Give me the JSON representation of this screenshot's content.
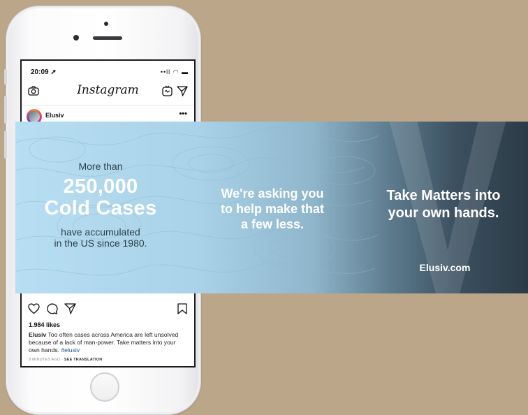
{
  "status_bar": {
    "time": "20:09 ➚",
    "icons": "••ll ◠ ▬"
  },
  "app": {
    "name": "Instagram"
  },
  "post": {
    "username": "Elusiv",
    "more": "•••",
    "likes": "1.984 likes",
    "caption_user": "Elusiv",
    "caption_text": " Too often cases across America are left unsolved because of a lack of man-power. Take matters into your own hands. ",
    "hashtag": "#elusiv",
    "time_ago": "8 MINUTES AGO",
    "separator": " · ",
    "see_translation": "SEE TRANSLATION"
  },
  "banner": {
    "more_than": "More than",
    "big_number": "250,000",
    "big_text": "Cold Cases",
    "since_line1": "have accumulated",
    "since_line2": "in the US since 1980.",
    "ask_line1": "We're asking you",
    "ask_line2": "to help make that",
    "ask_line3": "a few less.",
    "cta_line1": "Take Matters into",
    "cta_line2": "your own hands.",
    "url": "Elusiv.com"
  },
  "colors": {
    "background": "#bca68a",
    "banner_light": "#b7def2",
    "banner_dark": "#2c3b46"
  },
  "icons": [
    "camera-icon",
    "igtv-icon",
    "direct-message-icon",
    "heart-icon",
    "comment-icon",
    "share-icon",
    "bookmark-icon"
  ]
}
